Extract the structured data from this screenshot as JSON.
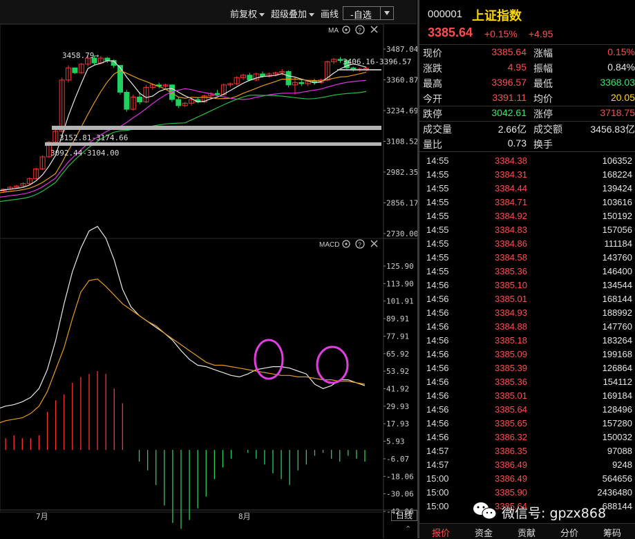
{
  "toolbar": {
    "restore_right": "前复权",
    "super_overlay": "超级叠加",
    "draw_line": "画线",
    "self_select": "-自选"
  },
  "chart": {
    "main": {
      "indicator": "MA",
      "y_ticks": [
        "3487.04",
        "3360.87",
        "3234.69",
        "3108.52",
        "2982.35",
        "2856.17",
        "2730.00"
      ],
      "annotations": [
        "3458.79→",
        "3406.16-3396.57",
        "3152.81-3174.66",
        "3092.44-3104.00"
      ]
    },
    "macd": {
      "indicator": "MACD",
      "y_ticks": [
        "125.90",
        "113.90",
        "101.91",
        "89.91",
        "77.91",
        "65.92",
        "53.92",
        "41.92",
        "29.93",
        "17.93",
        "5.93",
        "-6.07",
        "-18.06",
        "-30.06",
        "-42.06"
      ]
    },
    "x_labels": [
      "7月",
      "8月"
    ],
    "period_button": "日线",
    "colors": {
      "up": "#ff3333",
      "down": "#1fd15e",
      "ma5": "#e8e8e8",
      "ma10": "#e59a1a",
      "ma20": "#e02fe0",
      "ma30": "#22c040",
      "dif": "#e8e8e8",
      "dea": "#e59a1a",
      "circle": "#e33ce3"
    }
  },
  "chart_data": {
    "type": "candlestick",
    "title": "上证指数",
    "x_ticks": [
      "7月",
      "8月"
    ],
    "price_axis": {
      "min": 2730.0,
      "max": 3487.04
    },
    "candles": [
      [
        2900,
        2910,
        2895,
        2905
      ],
      [
        2905,
        2915,
        2900,
        2912
      ],
      [
        2912,
        2925,
        2908,
        2920
      ],
      [
        2920,
        2930,
        2915,
        2925
      ],
      [
        2925,
        2940,
        2920,
        2935
      ],
      [
        2935,
        2960,
        2930,
        2955
      ],
      [
        2955,
        3000,
        2950,
        2995
      ],
      [
        2995,
        3050,
        2990,
        3045
      ],
      [
        3045,
        3110,
        3040,
        3105
      ],
      [
        3105,
        3155,
        3095,
        3150
      ],
      [
        3150,
        3370,
        3145,
        3360
      ],
      [
        3360,
        3420,
        3350,
        3410
      ],
      [
        3410,
        3395,
        3385,
        3390
      ],
      [
        3390,
        3430,
        3385,
        3425
      ],
      [
        3425,
        3460,
        3415,
        3450
      ],
      [
        3450,
        3460,
        3420,
        3430
      ],
      [
        3430,
        3459,
        3425,
        3450
      ],
      [
        3450,
        3455,
        3430,
        3440
      ],
      [
        3440,
        3445,
        3410,
        3420
      ],
      [
        3420,
        3330,
        3300,
        3310
      ],
      [
        3310,
        3320,
        3230,
        3240
      ],
      [
        3240,
        3300,
        3235,
        3290
      ],
      [
        3290,
        3310,
        3260,
        3270
      ],
      [
        3270,
        3340,
        3265,
        3330
      ],
      [
        3330,
        3345,
        3320,
        3340
      ],
      [
        3340,
        3350,
        3325,
        3335
      ],
      [
        3335,
        3345,
        3320,
        3340
      ],
      [
        3340,
        3342,
        3270,
        3280
      ],
      [
        3280,
        3290,
        3245,
        3255
      ],
      [
        3255,
        3270,
        3250,
        3265
      ],
      [
        3265,
        3285,
        3255,
        3280
      ],
      [
        3280,
        3290,
        3265,
        3270
      ],
      [
        3270,
        3300,
        3265,
        3295
      ],
      [
        3295,
        3310,
        3285,
        3305
      ],
      [
        3305,
        3320,
        3295,
        3300
      ],
      [
        3300,
        3345,
        3295,
        3340
      ],
      [
        3340,
        3350,
        3330,
        3345
      ],
      [
        3345,
        3375,
        3340,
        3370
      ],
      [
        3370,
        3385,
        3360,
        3380
      ],
      [
        3380,
        3390,
        3355,
        3360
      ],
      [
        3360,
        3390,
        3355,
        3385
      ],
      [
        3385,
        3395,
        3370,
        3375
      ],
      [
        3375,
        3390,
        3370,
        3385
      ],
      [
        3385,
        3395,
        3375,
        3390
      ],
      [
        3390,
        3405,
        3380,
        3395
      ],
      [
        3395,
        3400,
        3330,
        3340
      ],
      [
        3340,
        3370,
        3300,
        3350
      ],
      [
        3350,
        3365,
        3335,
        3345
      ],
      [
        3345,
        3360,
        3335,
        3355
      ],
      [
        3355,
        3365,
        3340,
        3350
      ],
      [
        3350,
        3365,
        3345,
        3360
      ],
      [
        3360,
        3440,
        3355,
        3435
      ],
      [
        3435,
        3450,
        3425,
        3445
      ],
      [
        3445,
        3455,
        3430,
        3440
      ],
      [
        3440,
        3445,
        3400,
        3410
      ],
      [
        3410,
        3415,
        3395,
        3400
      ],
      [
        3400,
        3410,
        3395,
        3405
      ],
      [
        3405,
        3415,
        3395,
        3408
      ]
    ],
    "macd_dif": [
      28,
      30,
      31,
      33,
      36,
      42,
      55,
      75,
      100,
      122,
      138,
      150,
      153,
      145,
      130,
      110,
      98,
      92,
      88,
      84,
      80,
      75,
      68,
      62,
      58,
      57,
      55,
      53,
      51,
      50,
      52,
      55,
      56,
      57,
      57,
      56,
      54,
      52,
      45,
      42,
      44,
      48,
      48,
      46,
      44
    ],
    "macd_dea": [
      18,
      20,
      21,
      22,
      25,
      30,
      40,
      55,
      70,
      90,
      108,
      116,
      117,
      112,
      106,
      100,
      96,
      92,
      88,
      85,
      80,
      76,
      72,
      68,
      64,
      60,
      58,
      58,
      57,
      56,
      55,
      54,
      53,
      52,
      51,
      51,
      50,
      50,
      49,
      48,
      48,
      47,
      47,
      46,
      45
    ],
    "macd_hist": [
      10,
      8,
      10,
      8,
      8,
      10,
      26,
      34,
      38,
      46,
      50,
      52,
      54,
      52,
      42,
      32,
      0,
      -8,
      -14,
      -24,
      -38,
      -50,
      -54,
      -48,
      -40,
      -32,
      -20,
      -12,
      -6,
      0,
      -2,
      -6,
      -10,
      -16,
      -20,
      -24,
      -14,
      -10,
      -4,
      -2,
      -6,
      -8,
      -4,
      -6,
      -8
    ],
    "macd_range": {
      "min": -42.06,
      "max": 125.9
    }
  },
  "quote": {
    "code": "000001",
    "name": "上证指数",
    "price": "3385.64",
    "pct": "+0.15%",
    "change": "+4.95",
    "rows": [
      {
        "l1": "现价",
        "v1": "3385.64",
        "c1": "red",
        "l2": "涨幅",
        "v2": "0.15%",
        "c2": "red"
      },
      {
        "l1": "涨跌",
        "v1": "4.95",
        "c1": "red",
        "l2": "振幅",
        "v2": "0.84%",
        "c2": "wht"
      },
      {
        "l1": "最高",
        "v1": "3396.57",
        "c1": "red",
        "l2": "最低",
        "v2": "3368.03",
        "c2": "grn"
      },
      {
        "l1": "今开",
        "v1": "3391.11",
        "c1": "red",
        "l2": "均价",
        "v2": "20.05",
        "c2": "yel"
      },
      {
        "l1": "跌停",
        "v1": "3042.61",
        "c1": "grn",
        "l2": "涨停",
        "v2": "3718.75",
        "c2": "red"
      },
      {
        "l1": "成交量",
        "v1": "2.66亿",
        "c1": "wht",
        "l2": "成交额",
        "v2": "3456.83亿",
        "c2": "wht"
      },
      {
        "l1": "量比",
        "v1": "0.73",
        "c1": "wht",
        "l2": "换手",
        "v2": "",
        "c2": "wht"
      }
    ],
    "ticks": [
      {
        "t": "14:55",
        "p": "3384.38",
        "v": "106352"
      },
      {
        "t": "14:55",
        "p": "3384.31",
        "v": "168224"
      },
      {
        "t": "14:55",
        "p": "3384.44",
        "v": "139424"
      },
      {
        "t": "14:55",
        "p": "3384.71",
        "v": "103616"
      },
      {
        "t": "14:55",
        "p": "3384.92",
        "v": "150192"
      },
      {
        "t": "14:55",
        "p": "3384.83",
        "v": "157056"
      },
      {
        "t": "14:55",
        "p": "3384.86",
        "v": "111184"
      },
      {
        "t": "14:55",
        "p": "3384.58",
        "v": "143760"
      },
      {
        "t": "14:55",
        "p": "3385.36",
        "v": "146400"
      },
      {
        "t": "14:56",
        "p": "3385.10",
        "v": "134544"
      },
      {
        "t": "14:56",
        "p": "3385.01",
        "v": "168144"
      },
      {
        "t": "14:56",
        "p": "3384.93",
        "v": "188992"
      },
      {
        "t": "14:56",
        "p": "3384.88",
        "v": "147760"
      },
      {
        "t": "14:56",
        "p": "3385.18",
        "v": "183264"
      },
      {
        "t": "14:56",
        "p": "3385.09",
        "v": "199168"
      },
      {
        "t": "14:56",
        "p": "3385.39",
        "v": "126864"
      },
      {
        "t": "14:56",
        "p": "3385.36",
        "v": "154112"
      },
      {
        "t": "14:56",
        "p": "3385.01",
        "v": "169184"
      },
      {
        "t": "14:56",
        "p": "3385.64",
        "v": "128496"
      },
      {
        "t": "14:56",
        "p": "3385.65",
        "v": "157280"
      },
      {
        "t": "14:56",
        "p": "3386.32",
        "v": "150032"
      },
      {
        "t": "14:57",
        "p": "3386.35",
        "v": "97088"
      },
      {
        "t": "14:57",
        "p": "3386.49",
        "v": "9248"
      },
      {
        "t": "15:00",
        "p": "3386.49",
        "v": "564656"
      },
      {
        "t": "15:00",
        "p": "3385.90",
        "v": "2436480"
      },
      {
        "t": "15:00",
        "p": "3385.64",
        "v": "688144"
      }
    ],
    "tabs": [
      "报价",
      "资金",
      "贡献",
      "分价",
      "筹码"
    ]
  },
  "watermark": "微信号: gpzx868"
}
